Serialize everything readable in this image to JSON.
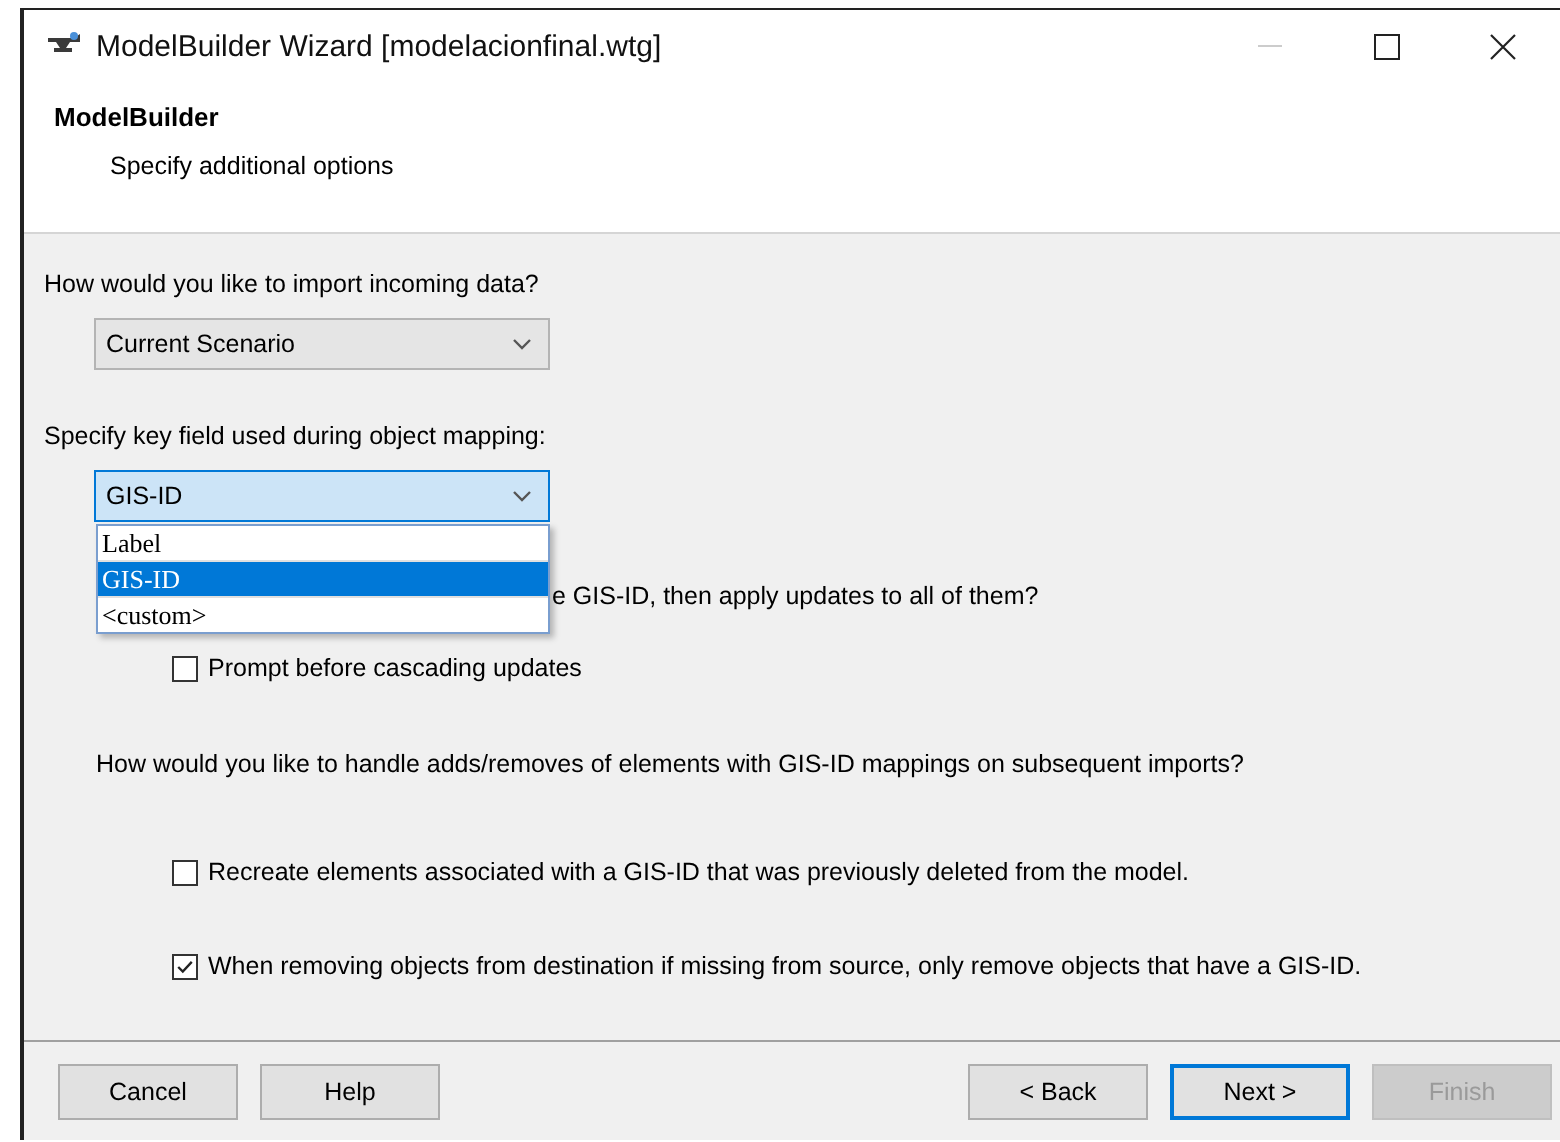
{
  "window": {
    "title": "ModelBuilder Wizard [modelacionfinal.wtg]"
  },
  "header": {
    "title": "ModelBuilder",
    "subtitle": "Specify additional options"
  },
  "import_question": {
    "label": "How would you like to import incoming data?",
    "dropdown": {
      "value": "Current Scenario",
      "focused": false
    }
  },
  "key_field": {
    "label": "Specify key field used during object mapping:",
    "dropdown": {
      "value": "GIS-ID",
      "focused": true,
      "expanded": true,
      "options": [
        {
          "label": "Label",
          "selected": false
        },
        {
          "label": "GIS-ID",
          "selected": true
        },
        {
          "label": "<custom>",
          "selected": false
        }
      ]
    }
  },
  "cascade": {
    "question": "e GIS-ID, then apply updates to all of them?",
    "checkbox": {
      "label": "Prompt before cascading updates",
      "checked": false
    }
  },
  "adds_removes": {
    "question": "How would you like to handle adds/removes of elements with GIS-ID mappings on subsequent imports?",
    "checkboxes": [
      {
        "label": "Recreate elements associated with a GIS-ID that was previously deleted from the model.",
        "checked": false
      },
      {
        "label": "When removing objects from destination if missing from source, only remove objects that have a GIS-ID.",
        "checked": true
      }
    ]
  },
  "left_buttons": [
    {
      "label": "Cancel",
      "disabled": false,
      "focused": false
    },
    {
      "label": "Help",
      "disabled": false,
      "focused": false
    }
  ],
  "right_buttons": [
    {
      "label": "< Back",
      "disabled": false,
      "focused": false
    },
    {
      "label": "Next >",
      "disabled": false,
      "focused": true
    },
    {
      "label": "Finish",
      "disabled": true,
      "focused": false
    }
  ]
}
